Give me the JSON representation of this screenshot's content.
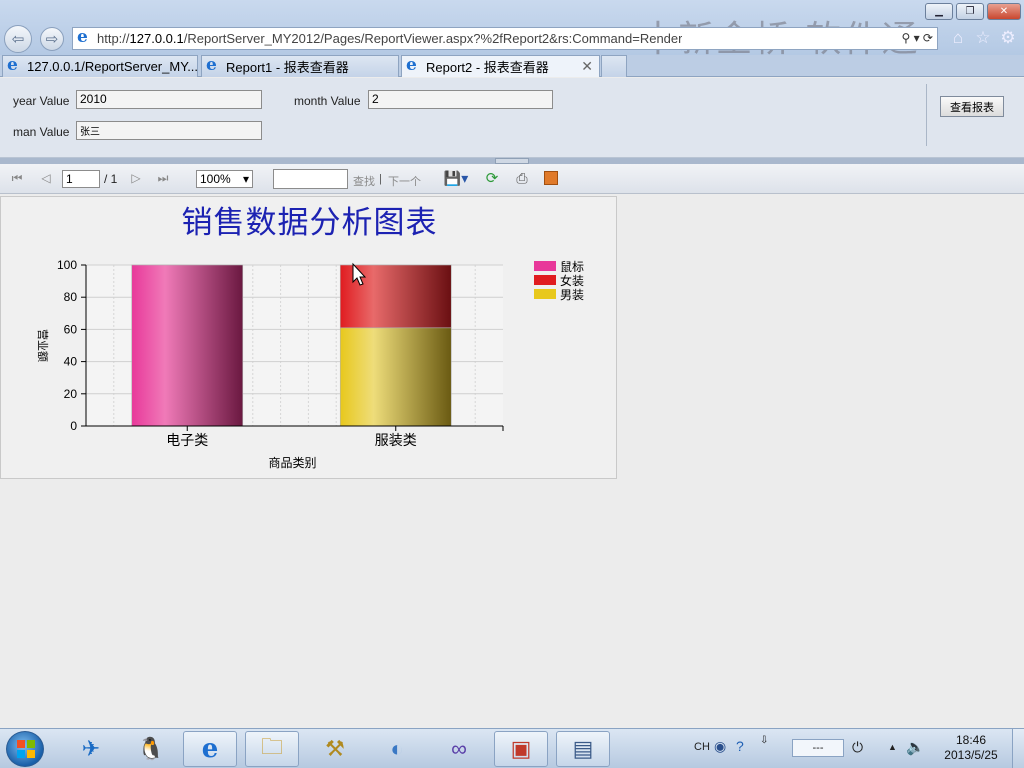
{
  "browser": {
    "url": "http://127.0.0.1/ReportServer_MY2012/Pages/ReportViewer.aspx?%2fReport2&rs:Command=Render",
    "url_prefix": "http://",
    "url_host": "127.0.0.1",
    "url_path": "/ReportServer_MY2012/Pages/ReportViewer.aspx?%2fReport2&rs:Command=Render",
    "watermark": "中新金桥 软件通",
    "tabs": [
      {
        "label": "127.0.0.1/ReportServer_MY...",
        "active": false
      },
      {
        "label": "Report1 - 报表查看器",
        "active": false
      },
      {
        "label": "Report2 - 报表查看器",
        "active": true
      }
    ]
  },
  "parameters": {
    "year": {
      "label": "year Value",
      "value": "2010"
    },
    "month": {
      "label": "month Value",
      "value": "2"
    },
    "man": {
      "label": "man Value",
      "value": "张三"
    },
    "view_report_label": "查看报表"
  },
  "toolbar": {
    "page_current": "1",
    "page_total": "/ 1",
    "zoom": "100%",
    "find_text": "",
    "find_label": "查找",
    "separator": "|",
    "next_label": "下一个"
  },
  "report": {
    "title": "销售数据分析图表"
  },
  "chart_data": {
    "type": "bar",
    "stacked": true,
    "categories": [
      "电子类",
      "服装类"
    ],
    "series": [
      {
        "name": "鼠标",
        "values": [
          100,
          0
        ],
        "color": "#e8389a"
      },
      {
        "name": "女装",
        "values": [
          0,
          39
        ],
        "color": "#e01c20"
      },
      {
        "name": "男装",
        "values": [
          0,
          61
        ],
        "color": "#e8c81c"
      }
    ],
    "ylim": [
      0,
      100
    ],
    "yticks": [
      0,
      20,
      40,
      60,
      80,
      100
    ],
    "xlabel": "商品类别",
    "ylabel": "营业额",
    "legend": "top-right",
    "grid": true
  },
  "taskbar": {
    "lang": "CH",
    "net_status": "---",
    "time": "18:46",
    "date": "2013/5/25"
  }
}
